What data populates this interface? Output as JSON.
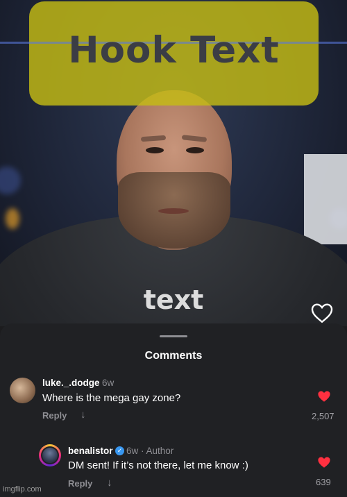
{
  "video": {
    "hook_text": "Hook Text",
    "caption_text": "text",
    "hook_box_color": "#c4bc14"
  },
  "comments_sheet": {
    "title": "Comments",
    "comments": [
      {
        "username": "luke._.dodge",
        "age": "6w",
        "text": "Where is the mega gay zone?",
        "reply_label": "Reply",
        "likes": "2,507",
        "liked": true
      },
      {
        "username": "benalistor",
        "verified": true,
        "age": "6w · Author",
        "text": "DM sent! If it’s not there, let me know :)",
        "reply_label": "Reply",
        "likes": "639",
        "liked": true
      }
    ]
  },
  "watermark": "imgflip.com",
  "colors": {
    "like_red": "#ff3040",
    "verified_blue": "#3897f0"
  }
}
